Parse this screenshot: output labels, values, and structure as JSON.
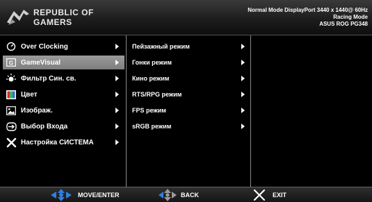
{
  "header": {
    "brand_line1": "REPUBLIC OF",
    "brand_line2": "GAMERS",
    "status_line1": "Normal Mode DisplayPort 3440 x 1440@ 60Hz",
    "status_line2": "Racing Mode",
    "status_line3": "ASUS ROG PG348"
  },
  "main_menu": [
    {
      "label": "Over Clocking",
      "icon": "speedometer-icon"
    },
    {
      "label": "GameVisual",
      "icon": "gamevisual-icon",
      "selected": true
    },
    {
      "label": "Фильтр Син. св.",
      "icon": "blue-light-icon"
    },
    {
      "label": "Цвет",
      "icon": "color-icon"
    },
    {
      "label": "Изображ.",
      "icon": "image-icon"
    },
    {
      "label": "Выбор Входа",
      "icon": "input-icon"
    },
    {
      "label": "Настройка СИСТЕМА",
      "icon": "system-setup-icon"
    }
  ],
  "sub_menu": [
    {
      "label": "Пейзажный режим"
    },
    {
      "label": "Гонки режим"
    },
    {
      "label": "Кино режим"
    },
    {
      "label": "RTS/RPG режим"
    },
    {
      "label": "FPS режим"
    },
    {
      "label": "sRGB режим"
    }
  ],
  "footer": {
    "move_enter": "MOVE/ENTER",
    "back": "BACK",
    "exit": "EXIT"
  },
  "colors": {
    "selection": "#8c8c8c",
    "nav_blue": "#2f7fe0",
    "nav_grey": "#9a9a9a"
  }
}
